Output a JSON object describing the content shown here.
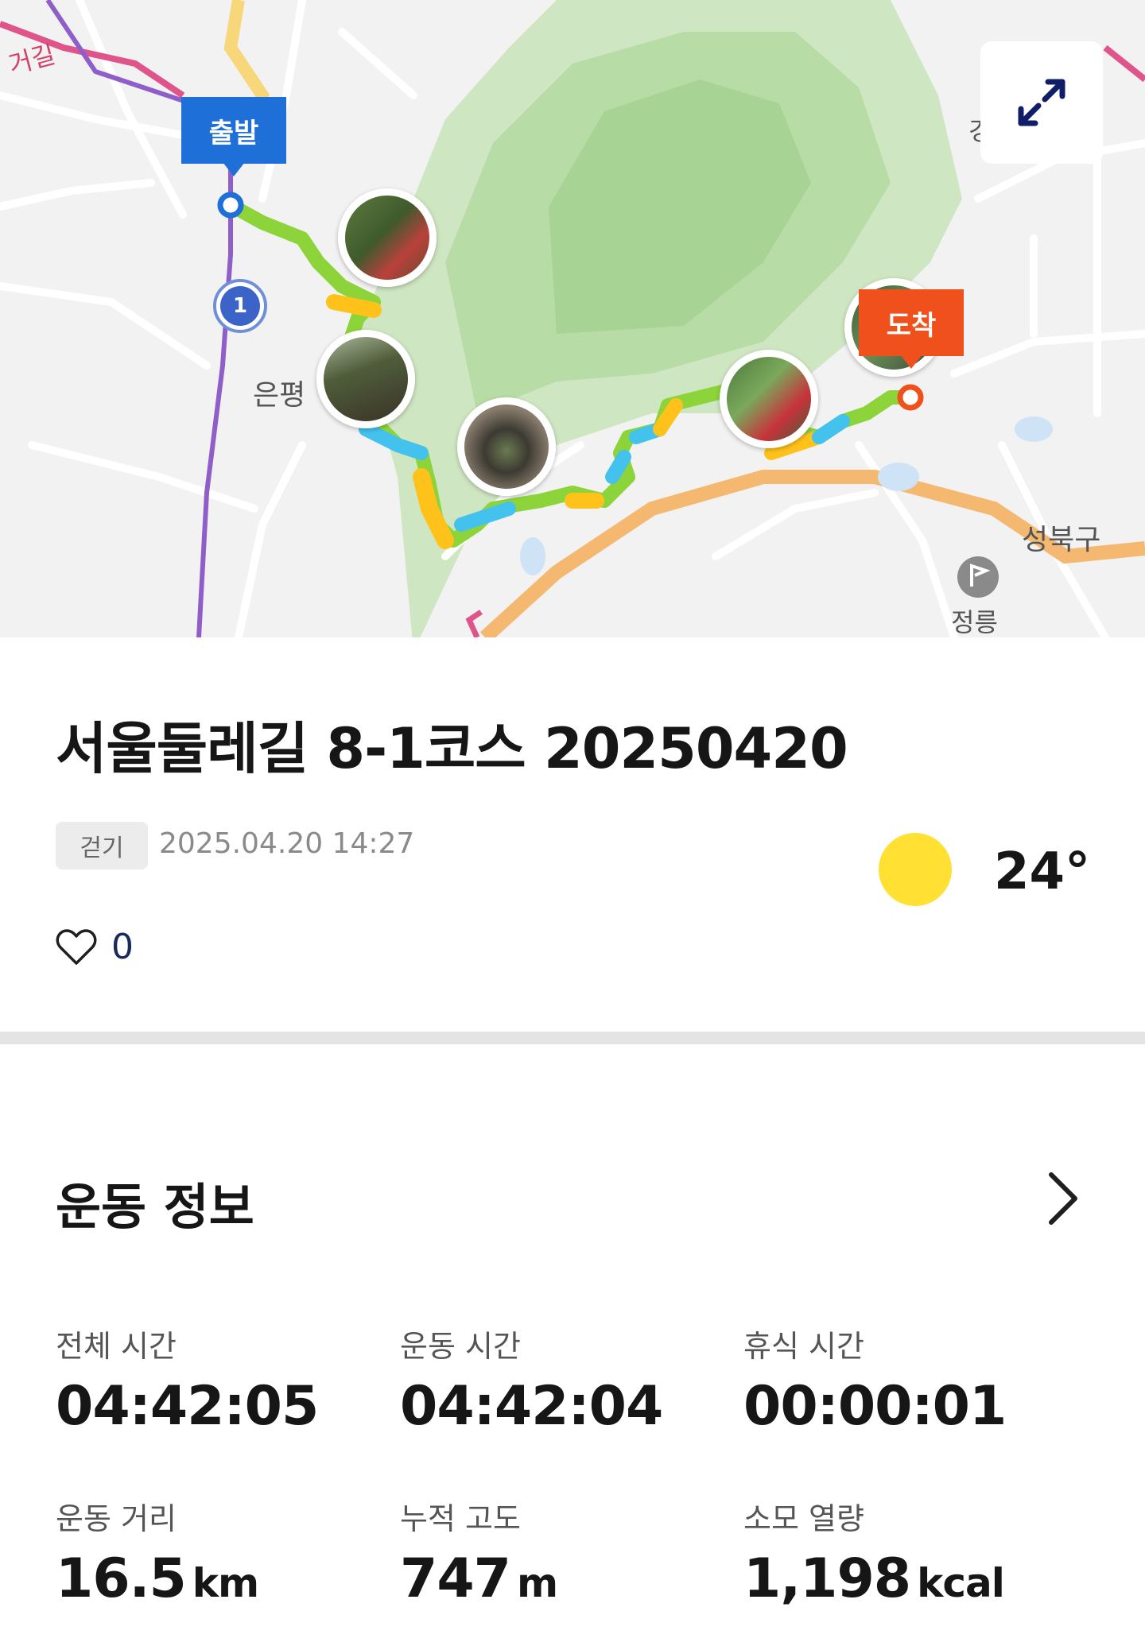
{
  "map": {
    "start_flag": "출발",
    "end_flag": "도착",
    "route_marker": "1",
    "labels": [
      {
        "id": "eunpyeong",
        "text": "은평"
      },
      {
        "id": "seongbuk",
        "text": "성북구"
      },
      {
        "id": "jeongneung",
        "text": "정릉"
      },
      {
        "id": "road-top-left",
        "text": "거길"
      },
      {
        "id": "edge-right",
        "text": "경"
      }
    ],
    "expand_icon": "expand-arrows-icon"
  },
  "activity": {
    "title": "서울둘레길 8-1코스 20250420",
    "type_tag": "걷기",
    "datetime": "2025.04.20 14:27",
    "weather_icon": "sun-icon",
    "temperature": "24°",
    "like_icon": "heart-icon",
    "likes": "0"
  },
  "exercise_info": {
    "heading": "운동 정보",
    "stats": [
      {
        "label": "전체 시간",
        "value": "04:42:05",
        "unit": ""
      },
      {
        "label": "운동 시간",
        "value": "04:42:04",
        "unit": ""
      },
      {
        "label": "휴식 시간",
        "value": "00:00:01",
        "unit": ""
      },
      {
        "label": "운동 거리",
        "value": "16.5",
        "unit": "km"
      },
      {
        "label": "누적 고도",
        "value": "747",
        "unit": "m"
      },
      {
        "label": "소모 열량",
        "value": "1,198",
        "unit": "kcal"
      }
    ]
  },
  "colors": {
    "start": "#1f6fd9",
    "end": "#f0501c",
    "route_green": "#8cd43a",
    "route_yellow": "#ffc21a",
    "route_cyan": "#43c2ee",
    "sun": "#ffe033"
  }
}
